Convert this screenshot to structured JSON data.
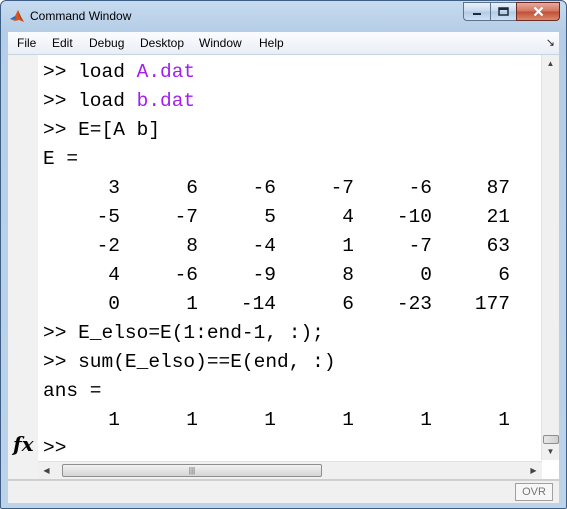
{
  "window": {
    "title": "Command Window",
    "icon": "matlab-logo-icon"
  },
  "menu": [
    "File",
    "Edit",
    "Debug",
    "Desktop",
    "Window",
    "Help"
  ],
  "console": {
    "prompt": ">>",
    "cmd1": {
      "keyword": "load",
      "arg": "A.dat"
    },
    "cmd2": {
      "keyword": "load",
      "arg": "b.dat"
    },
    "cmd3": "E=[A b]",
    "e_label": "E =",
    "matrix_E": [
      [
        "3",
        "6",
        "-6",
        "-7",
        "-6",
        "87"
      ],
      [
        "-5",
        "-7",
        "5",
        "4",
        "-10",
        "21"
      ],
      [
        "-2",
        "8",
        "-4",
        "1",
        "-7",
        "63"
      ],
      [
        "4",
        "-6",
        "-9",
        "8",
        "0",
        "6"
      ],
      [
        "0",
        "1",
        "-14",
        "6",
        "-23",
        "177"
      ]
    ],
    "cmd4": "E_elso=E(1:end-1, :);",
    "cmd5": "sum(E_elso)==E(end, :)",
    "ans_label": "ans =",
    "ans_row": [
      "1",
      "1",
      "1",
      "1",
      "1",
      "1"
    ],
    "fx_label": "fx"
  },
  "statusbar": {
    "ovr": "OVR"
  },
  "colors": {
    "command_arg": "#a020f0"
  }
}
